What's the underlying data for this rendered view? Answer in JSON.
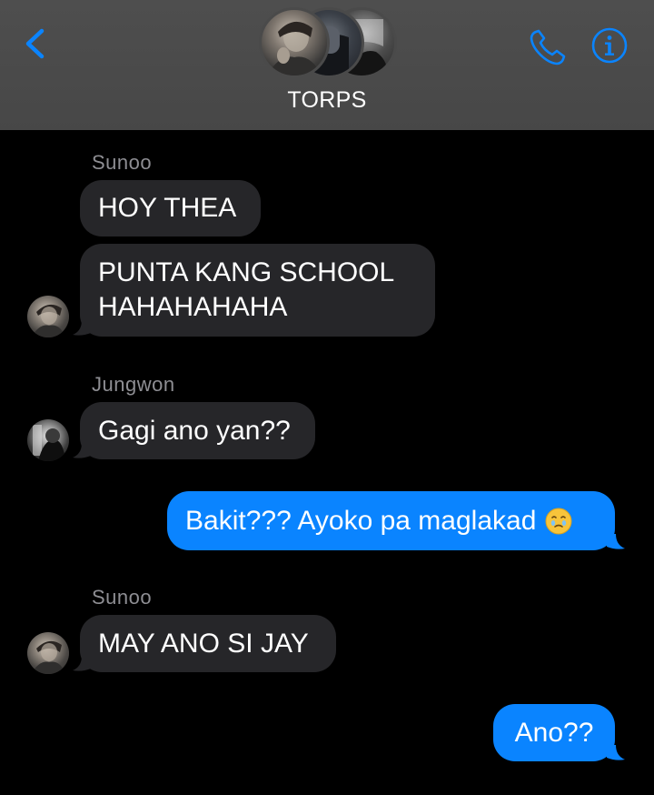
{
  "header": {
    "title": "TORPS",
    "back_icon": "chevron-left-icon",
    "phone_icon": "phone-icon",
    "info_icon": "info-icon",
    "accent_color": "#0a84ff"
  },
  "messages": [
    {
      "sender": "Sunoo",
      "direction": "incoming",
      "text": "HOY THEA"
    },
    {
      "sender": "Sunoo",
      "direction": "incoming",
      "text_lines": [
        "PUNTA KANG SCHOOL",
        "HAHAHAHAHA"
      ]
    },
    {
      "sender": "Jungwon",
      "direction": "incoming",
      "text": "Gagi ano yan??"
    },
    {
      "sender": "",
      "direction": "outgoing",
      "text": "Bakit??? Ayoko pa maglakad",
      "emoji": "face-holding-back-tears"
    },
    {
      "sender": "Sunoo",
      "direction": "incoming",
      "text": "MAY ANO SI JAY"
    },
    {
      "sender": "",
      "direction": "outgoing",
      "text": "Ano??"
    }
  ],
  "colors": {
    "incoming_bubble": "#262629",
    "outgoing_bubble": "#0a84ff",
    "sender_name": "#8e8e93",
    "background": "#000000"
  }
}
